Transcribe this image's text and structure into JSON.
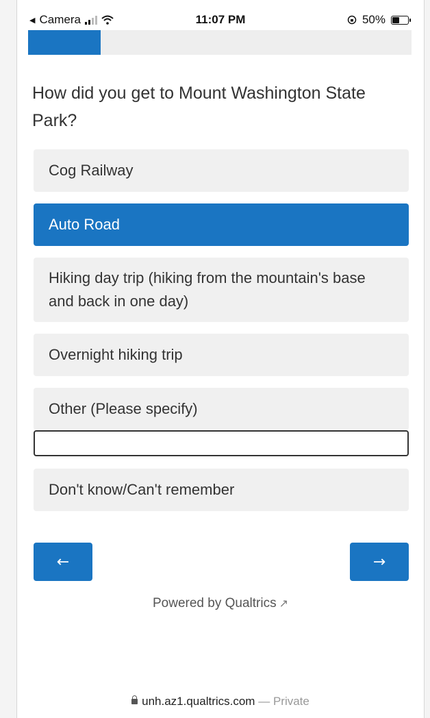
{
  "status_bar": {
    "back_app": "Camera",
    "time": "11:07 PM",
    "battery": "50%",
    "battery_level": 0.5
  },
  "progress": {
    "fraction": 0.19
  },
  "question": {
    "text": "How did you get to Mount Washington State Park?"
  },
  "choices": [
    {
      "label": "Cog Railway",
      "selected": false
    },
    {
      "label": "Auto Road",
      "selected": true
    },
    {
      "label": "Hiking day trip (hiking from the mountain's base and back in one day)",
      "selected": false
    },
    {
      "label": "Overnight hiking trip",
      "selected": false
    },
    {
      "label": "Other (Please specify)",
      "selected": false
    },
    {
      "label": "Don't know/Can't remember",
      "selected": false
    }
  ],
  "other_input": {
    "value": "",
    "placeholder": ""
  },
  "navigation": {
    "back_label": "←",
    "next_label": "→"
  },
  "footer": {
    "powered_by": "Powered by Qualtrics"
  },
  "url_bar": {
    "domain": "unh.az1.qualtrics.com",
    "separator": "—",
    "mode": "Private"
  },
  "colors": {
    "accent": "#1a75c2",
    "choice_bg": "#f0f0f0"
  },
  "icons": [
    "back-triangle-icon",
    "cellular-signal-icon",
    "wifi-icon",
    "orientation-lock-icon",
    "battery-icon",
    "external-link-icon",
    "lock-icon"
  ]
}
